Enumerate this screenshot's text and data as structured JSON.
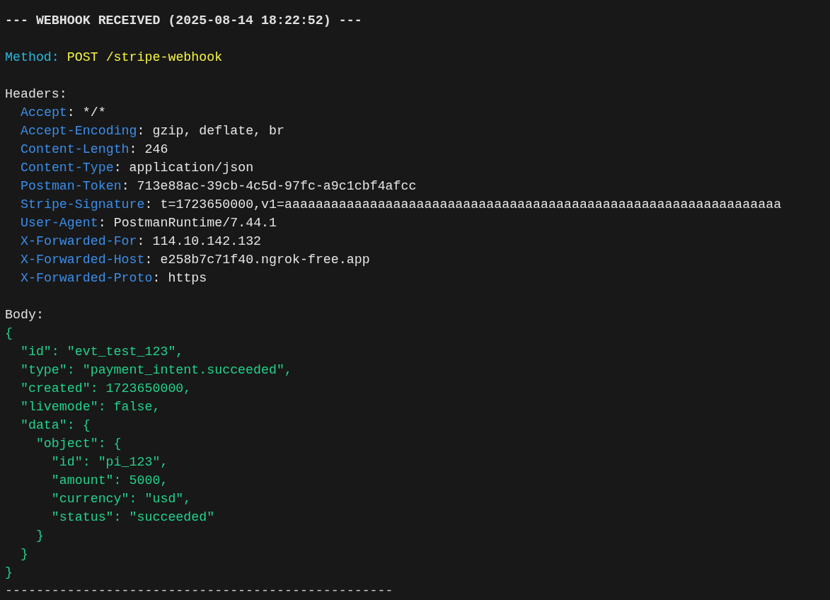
{
  "title": "--- WEBHOOK RECEIVED (2025-08-14 18:22:52) ---",
  "method": {
    "label": "Method:",
    "value": "POST /stripe-webhook"
  },
  "headers": {
    "label": "Headers:",
    "items": [
      {
        "name": "Accept",
        "value": ": */*"
      },
      {
        "name": "Accept-Encoding",
        "value": ": gzip, deflate, br"
      },
      {
        "name": "Content-Length",
        "value": ": 246"
      },
      {
        "name": "Content-Type",
        "value": ": application/json"
      },
      {
        "name": "Postman-Token",
        "value": ": 713e88ac-39cb-4c5d-97fc-a9c1cbf4afcc"
      },
      {
        "name": "Stripe-Signature",
        "value": ": t=1723650000,v1=aaaaaaaaaaaaaaaaaaaaaaaaaaaaaaaaaaaaaaaaaaaaaaaaaaaaaaaaaaaaaaaa"
      },
      {
        "name": "User-Agent",
        "value": ": PostmanRuntime/7.44.1"
      },
      {
        "name": "X-Forwarded-For",
        "value": ": 114.10.142.132"
      },
      {
        "name": "X-Forwarded-Host",
        "value": ": e258b7c71f40.ngrok-free.app"
      },
      {
        "name": "X-Forwarded-Proto",
        "value": ": https"
      }
    ]
  },
  "body": {
    "label": "Body:",
    "lines": [
      "{",
      "  \"id\": \"evt_test_123\",",
      "  \"type\": \"payment_intent.succeeded\",",
      "  \"created\": 1723650000,",
      "  \"livemode\": false,",
      "  \"data\": {",
      "    \"object\": {",
      "      \"id\": \"pi_123\",",
      "      \"amount\": 5000,",
      "      \"currency\": \"usd\",",
      "      \"status\": \"succeeded\"",
      "    }",
      "  }",
      "}"
    ]
  },
  "separator": "--------------------------------------------------"
}
